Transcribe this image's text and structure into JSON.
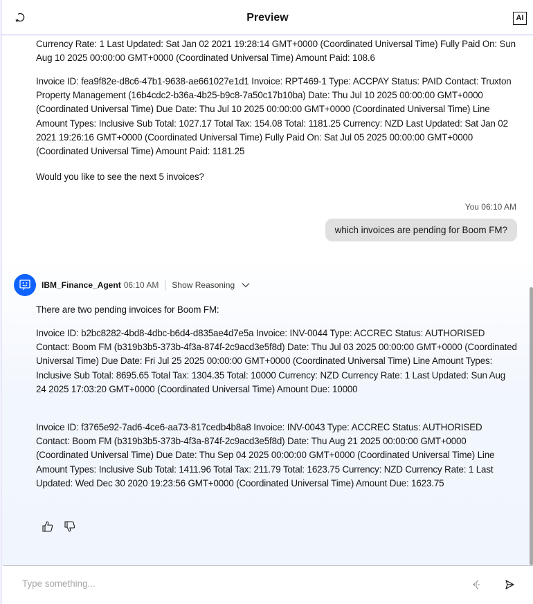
{
  "header": {
    "title": "Preview",
    "restart_icon": "restart-icon",
    "ai_label": "AI"
  },
  "messages": {
    "prev_tail": "Currency Rate: 1 Last Updated: Sat Jan 02 2021 19:28:14 GMT+0000 (Coordinated Universal Time) Fully Paid On: Sun Aug 10 2025 00:00:00 GMT+0000 (Coordinated Universal Time) Amount Paid: 108.6",
    "prev_invoice": "Invoice ID: fea9f82e-d8c6-47b1-9638-ae661027e1d1 Invoice: RPT469-1 Type: ACCPAY Status: PAID Contact: Truxton Property Management (16b4cdc2-b36a-4b25-b9c8-7a50c17b10ba) Date: Thu Jul 10 2025 00:00:00 GMT+0000 (Coordinated Universal Time) Due Date: Thu Jul 10 2025 00:00:00 GMT+0000 (Coordinated Universal Time) Line Amount Types: Inclusive Sub Total: 1027.17 Total Tax: 154.08 Total: 1181.25 Currency: NZD Last Updated: Sat Jan 02 2021 19:26:16 GMT+0000 (Coordinated Universal Time) Fully Paid On: Sat Jul 05 2025 00:00:00 GMT+0000 (Coordinated Universal Time) Amount Paid: 1181.25",
    "prev_question": "Would you like to see the next 5 invoices?",
    "user_meta": "You 06:10 AM",
    "user_text": "which invoices are pending for Boom FM?",
    "agent_name": "IBM_Finance_Agent",
    "agent_time": "06:10 AM",
    "show_reasoning": "Show Reasoning",
    "agent_intro": "There are two pending invoices for Boom FM:",
    "agent_invoice_1": "Invoice ID: b2bc8282-4bd8-4dbc-b6d4-d835ae4d7e5a Invoice: INV-0044 Type: ACCREC Status: AUTHORISED Contact: Boom FM (b319b3b5-373b-4f3a-874f-2c9acd3e5f8d) Date: Thu Jul 03 2025 00:00:00 GMT+0000 (Coordinated Universal Time) Due Date: Fri Jul 25 2025 00:00:00 GMT+0000 (Coordinated Universal Time) Line Amount Types: Inclusive Sub Total: 8695.65 Total Tax: 1304.35 Total: 10000 Currency: NZD Currency Rate: 1 Last Updated: Sun Aug 24 2025 17:03:20 GMT+0000 (Coordinated Universal Time) Amount Due: 10000",
    "agent_invoice_2": "Invoice ID: f3765e92-7ad6-4ce6-aa73-817cedb4b8a8 Invoice: INV-0043 Type: ACCREC Status: AUTHORISED Contact: Boom FM (b319b3b5-373b-4f3a-874f-2c9acd3e5f8d) Date: Thu Aug 21 2025 00:00:00 GMT+0000 (Coordinated Universal Time) Due Date: Thu Sep 04 2025 00:00:00 GMT+0000 (Coordinated Universal Time) Line Amount Types: Inclusive Sub Total: 1411.96 Total Tax: 211.79 Total: 1623.75 Currency: NZD Currency Rate: 1 Last Updated: Wed Dec 30 2020 19:23:56 GMT+0000 (Coordinated Universal Time) Amount Due: 1623.75"
  },
  "input": {
    "placeholder": "Type something...",
    "value": ""
  },
  "colors": {
    "accent": "#0f62fe",
    "user_bubble": "#e0e0e0",
    "agent_bg": "#f1f5fd"
  }
}
